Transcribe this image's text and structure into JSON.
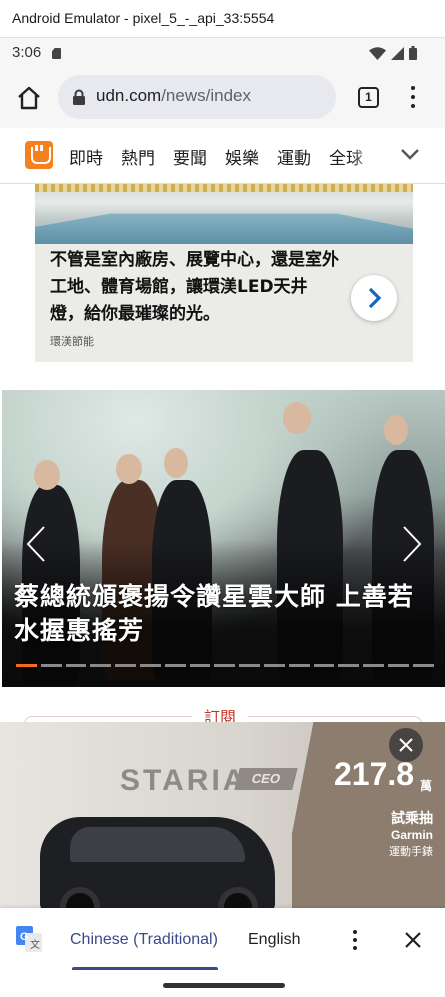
{
  "emulator": {
    "title": "Android Emulator - pixel_5_-_api_33:5554"
  },
  "status_bar": {
    "time": "3:06"
  },
  "browser": {
    "url_domain": "udn.com",
    "url_path": "/news/index",
    "tab_count": "1"
  },
  "nav": {
    "items": [
      "即時",
      "熱門",
      "要聞",
      "娛樂",
      "運動",
      "全球"
    ],
    "accent_color": "#f5801f"
  },
  "ad_top": {
    "text": "不管是室內廠房、展覽中心，還是室外工地、體育場館，讓環渼LED天井燈，給你最璀璨的光。",
    "brand": "環渼節能"
  },
  "slider": {
    "headline": "蔡總統頒褒揚令讚星雲大師 上善若水握惠搖芳",
    "slide_count": 17,
    "active_slide": 1,
    "active_color": "#f26b21"
  },
  "subscribe": {
    "label": "訂閱"
  },
  "ad_bottom": {
    "brand": "STARIA",
    "badge": "CEO",
    "price": "217.8",
    "price_unit": "萬",
    "promo_line1": "試乘抽",
    "promo_line2": "Garmin",
    "promo_line3": "運動手錶"
  },
  "translate_bar": {
    "source_language": "Chinese (Traditional)",
    "target_language": "English"
  }
}
